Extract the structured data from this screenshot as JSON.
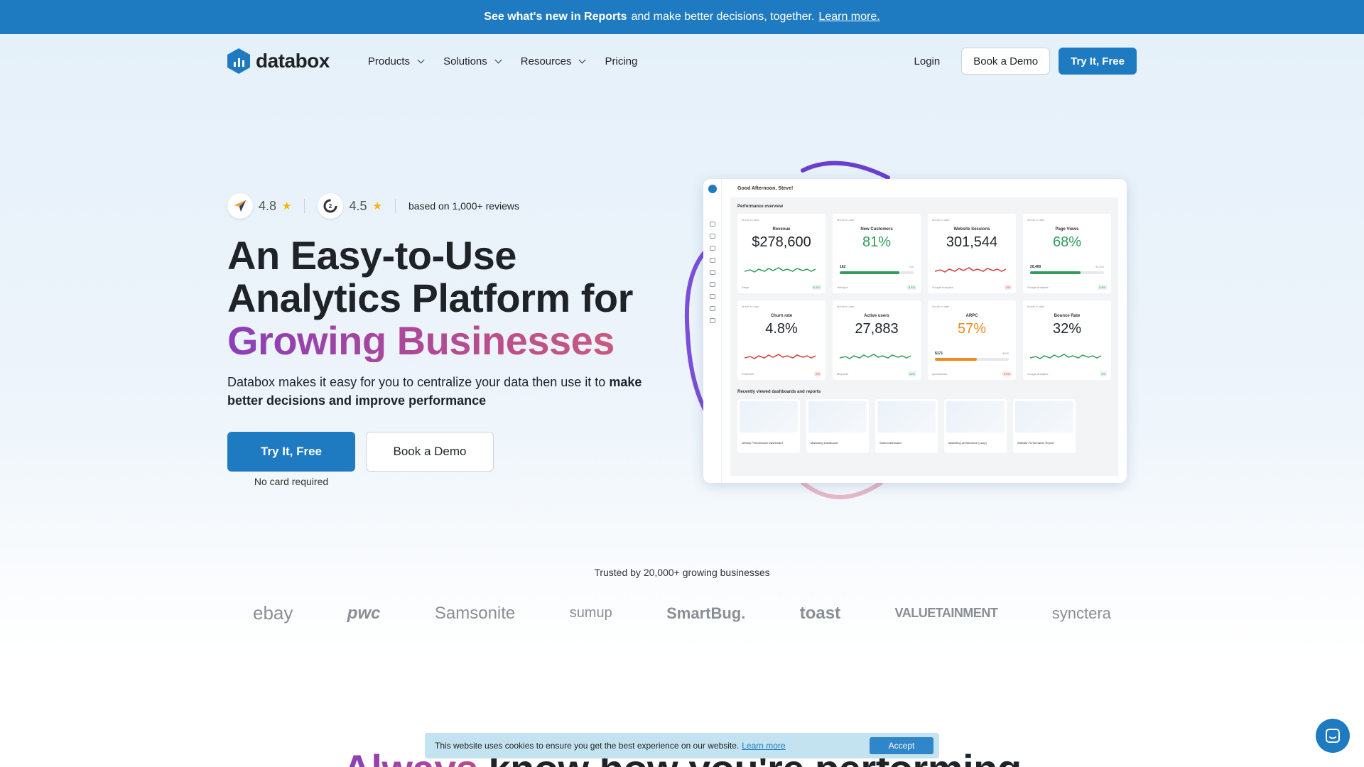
{
  "promo": {
    "bold": "See what's new in Reports",
    "text": "and make better decisions, together.",
    "link": "Learn more."
  },
  "nav": {
    "logo": "databox",
    "menu": [
      {
        "label": "Products"
      },
      {
        "label": "Solutions"
      },
      {
        "label": "Resources"
      },
      {
        "label": "Pricing"
      }
    ],
    "login": "Login",
    "book_demo": "Book a Demo",
    "try_free": "Try It, Free"
  },
  "ratings": {
    "capterra": "4.8",
    "g2": "4.5",
    "note": "based on 1,000+ reviews"
  },
  "hero": {
    "title_line1": "An Easy-to-Use",
    "title_line2": "Analytics Platform for",
    "title_line3": "Growing Businesses",
    "sub_plain": "Databox makes it easy for you to centralize your data then use it to",
    "sub_bold": "make better decisions and improve performance",
    "cta_primary": "Try It, Free",
    "cta_secondary": "Book a Demo",
    "no_card": "No card required"
  },
  "dashboard": {
    "greeting": "Good Afternoon, Steve!",
    "section": "Performance overview",
    "recent": "Recently viewed dashboards and reports",
    "cards": [
      {
        "period": "Month to date",
        "name": "Revenue",
        "value": "$278,600",
        "color": "default",
        "source": "Stripe",
        "change": "6.1%",
        "dir": "up",
        "kind": "spark",
        "spark": "#2e9c5a"
      },
      {
        "period": "Month to date",
        "name": "New Customers",
        "value": "81%",
        "color": "green",
        "source": "HubSpot",
        "change": "5.1%",
        "dir": "up",
        "kind": "bar",
        "fill": 0.81,
        "barcolor": "#2e9c5a",
        "left": "162",
        "right": "200"
      },
      {
        "period": "Month to date",
        "name": "Website Sessions",
        "value": "301,544",
        "color": "default",
        "source": "Google Analytics",
        "change": "2%",
        "dir": "down",
        "kind": "spark",
        "spark": "#d23c3c"
      },
      {
        "period": "Month to date",
        "name": "Page Views",
        "value": "68%",
        "color": "green",
        "source": "Google Analytics",
        "change": "3.4%",
        "dir": "up",
        "kind": "bar",
        "fill": 0.68,
        "barcolor": "#2e9c5a",
        "left": "20,400",
        "right": "30,000"
      },
      {
        "period": "Month to date",
        "name": "Churn rate",
        "value": "4.8%",
        "color": "default",
        "source": "ProfitWell",
        "change": "2%",
        "dir": "down",
        "kind": "spark",
        "spark": "#d23c3c"
      },
      {
        "period": "Month to date",
        "name": "Active users",
        "value": "27,883",
        "color": "default",
        "source": "Mixpanel",
        "change": "12%",
        "dir": "up",
        "kind": "spark",
        "spark": "#2e9c5a"
      },
      {
        "period": "Month to date",
        "name": "ARPC",
        "value": "57%",
        "color": "orange",
        "source": "QuickBooks",
        "change": "3.4%",
        "dir": "down",
        "kind": "bar",
        "fill": 0.57,
        "barcolor": "#ef8a22",
        "left": "$171",
        "right": "$300"
      },
      {
        "period": "Month to date",
        "name": "Bounce Rate",
        "value": "32%",
        "color": "default",
        "source": "Google Analytics",
        "change": "2%",
        "dir": "up",
        "kind": "spark",
        "spark": "#2e9c5a"
      }
    ],
    "thumbs": [
      "Weekly Performance Dashboard",
      "Marketing Dashboard",
      "Sales Dashboard",
      "Marketing performance (Loop)",
      "Website Performance Report"
    ]
  },
  "trusted": {
    "title": "Trusted by 20,000+ growing businesses",
    "logos": [
      "ebay",
      "pwc",
      "Samsonite",
      "sumup",
      "SmartBug.",
      "toast",
      "VALUETAINMENT",
      "synctera"
    ]
  },
  "below_title": {
    "grad": "Always",
    "rest": "know how you're performing"
  },
  "cookie": {
    "text": "This website uses cookies to ensure you get the best experience on our website.",
    "link": "Learn more",
    "accept": "Accept"
  },
  "colors": {
    "brand_blue": "#1f7bc1",
    "gradient_purple": "#8a3fb8",
    "gradient_pink": "#d0607a"
  }
}
